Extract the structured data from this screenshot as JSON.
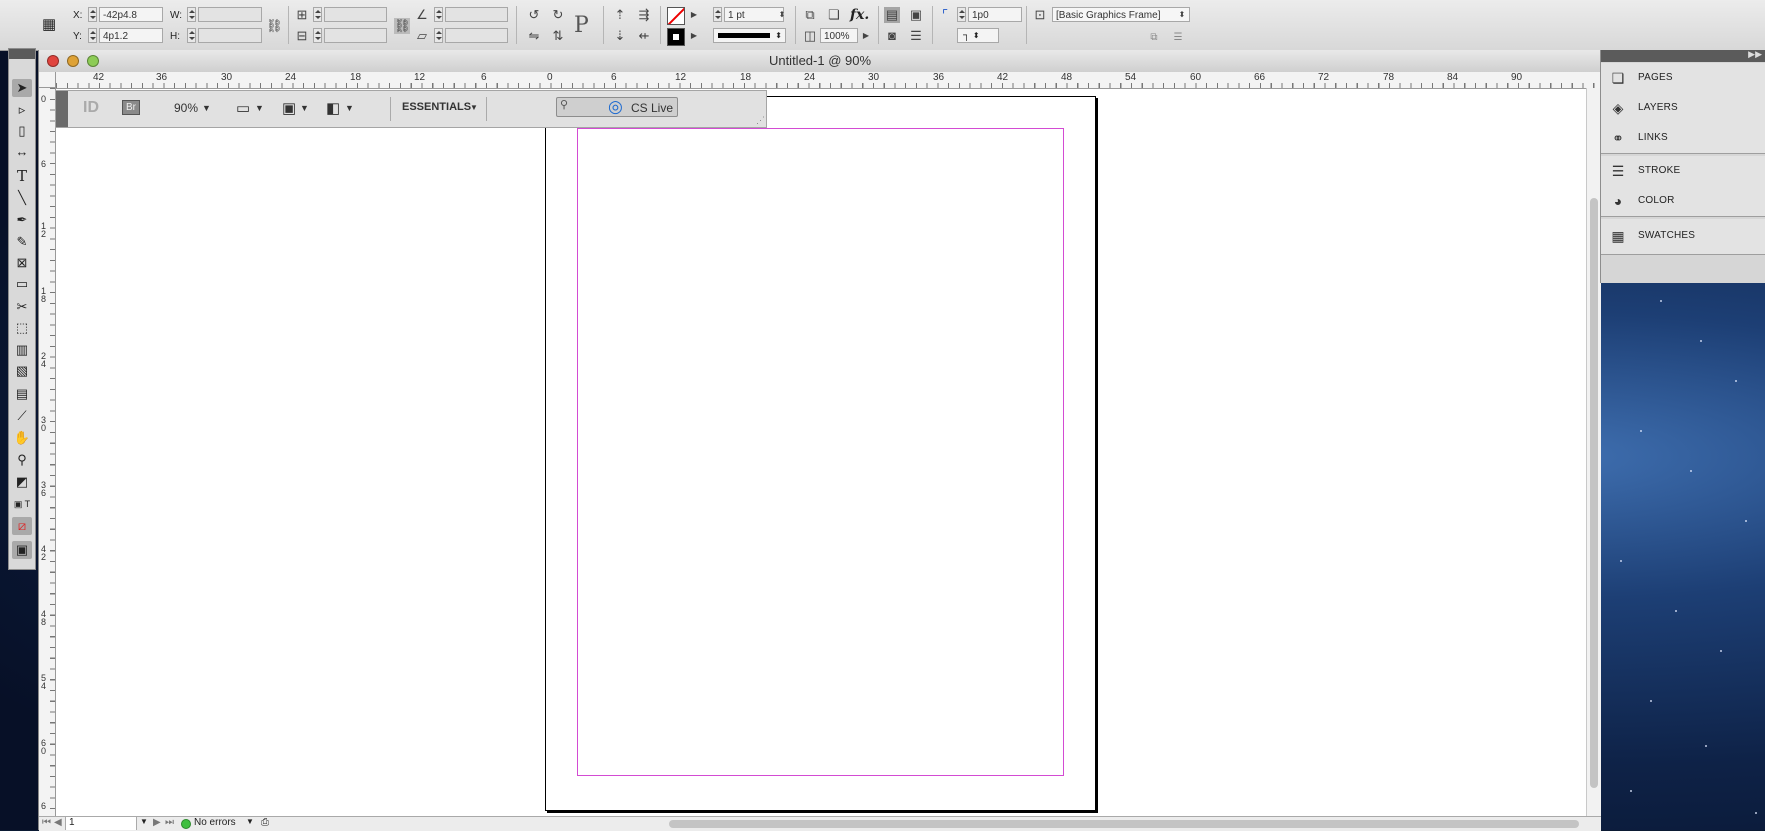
{
  "window": {
    "title": "Untitled-1 @ 90%"
  },
  "control_bar": {
    "x_label": "X:",
    "x_value": "-42p4.8",
    "y_label": "Y:",
    "y_value": "4p1.2",
    "w_label": "W:",
    "w_value": "",
    "h_label": "H:",
    "h_value": "",
    "stroke_weight": "1 pt",
    "opacity": "100%",
    "corner_value": "1p0",
    "object_style": "[Basic Graphics Frame]"
  },
  "app_bar": {
    "logo": "ID",
    "bridge": "Br",
    "zoom": "90%",
    "workspace": "ESSENTIALS",
    "search_placeholder": "",
    "cs_live": "CS Live"
  },
  "rulers": {
    "horizontal": [
      "42",
      "36",
      "30",
      "24",
      "18",
      "12",
      "6",
      "0",
      "6",
      "12",
      "18",
      "24",
      "30",
      "36",
      "42",
      "48",
      "54",
      "60",
      "66",
      "72",
      "78",
      "84",
      "90"
    ],
    "vertical": [
      "0",
      "6",
      "12",
      "18",
      "24",
      "30",
      "36",
      "42",
      "48",
      "54",
      "60",
      "6"
    ]
  },
  "status_bar": {
    "page": "1",
    "preflight": "No errors"
  },
  "panels": {
    "group1": [
      {
        "label": "PAGES",
        "icon": "pages-icon"
      },
      {
        "label": "LAYERS",
        "icon": "layers-icon"
      },
      {
        "label": "LINKS",
        "icon": "links-icon"
      }
    ],
    "group2": [
      {
        "label": "STROKE",
        "icon": "stroke-icon"
      },
      {
        "label": "COLOR",
        "icon": "color-icon"
      }
    ],
    "group3": [
      {
        "label": "SWATCHES",
        "icon": "swatches-icon"
      }
    ]
  },
  "tools": [
    "selection-tool",
    "direct-selection-tool",
    "page-tool",
    "gap-tool",
    "type-tool",
    "line-tool",
    "pen-tool",
    "pencil-tool",
    "rectangle-frame-tool",
    "rectangle-tool",
    "scissors-tool",
    "free-transform-tool",
    "gradient-swatch-tool",
    "gradient-feather-tool",
    "note-tool",
    "eyedropper-tool",
    "hand-tool",
    "zoom-tool",
    "fill-stroke-swatch",
    "apply-none",
    "screen-mode"
  ]
}
